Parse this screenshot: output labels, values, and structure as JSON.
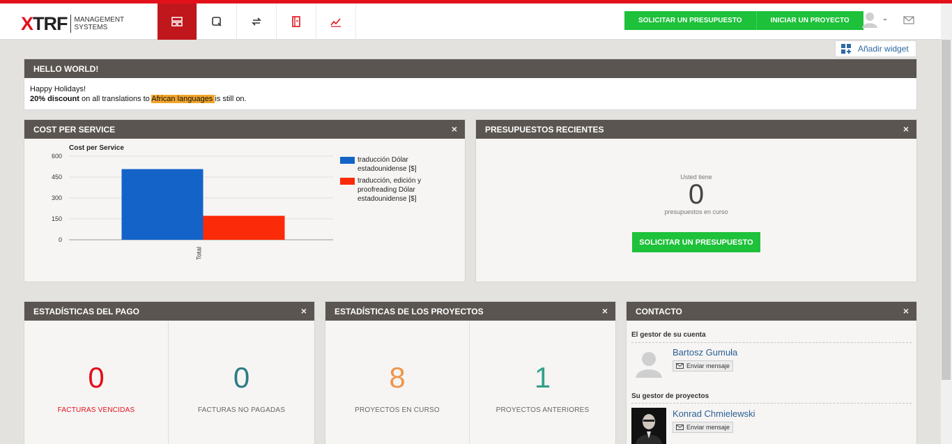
{
  "logo": {
    "mark": "XTRF",
    "line1": "MANAGEMENT",
    "line2": "SYSTEMS"
  },
  "nav": {
    "items": [
      "dashboard-icon",
      "search-icon",
      "refresh-icon",
      "book-icon",
      "chart-icon"
    ]
  },
  "header": {
    "btn_request_quote": "SOLICITAR UN PRESUPUESTO",
    "btn_start_project": "INICIAR UN PROYECTO"
  },
  "add_widget": "Añadir widget",
  "hello": {
    "title": "HELLO WORLD!",
    "line1": "Happy Holidays!",
    "bold": "20% discount",
    "mid": " on all translations to ",
    "highlight": "African languages ",
    "end": "is still on."
  },
  "cost_panel": {
    "title": "COST PER SERVICE",
    "close": "×"
  },
  "chart_data": {
    "type": "bar",
    "title": "Cost per Service",
    "categories": [
      "Total"
    ],
    "series": [
      {
        "name": "traducción Dólar estadounidense [$]",
        "values": [
          507
        ],
        "color": "#1463c9"
      },
      {
        "name": "traducción, edición y proofreading Dólar estadounidense [$]",
        "values": [
          172
        ],
        "color": "#fb2a08"
      }
    ],
    "yticks": [
      600,
      450,
      300,
      150,
      0
    ],
    "ylim": [
      0,
      600
    ],
    "legend": "right",
    "grid": true
  },
  "legend": {
    "s1_l1": "traducción Dólar",
    "s1_l2": "estadounidense [$]",
    "s2_l1": "traducción, edición y",
    "s2_l2": "proofreading Dólar",
    "s2_l3": "estadounidense [$]"
  },
  "quotes_panel": {
    "title": "PRESUPUESTOS RECIENTES",
    "close": "×",
    "you_have": "Usted tiene",
    "count": "0",
    "sub": "presupuestos en curso",
    "button": "SOLICITAR UN PRESUPUESTO"
  },
  "payment_panel": {
    "title": "ESTADÍSTICAS DEL PAGO",
    "close": "×",
    "overdue_value": "0",
    "overdue_label": "FACTURAS VENCIDAS",
    "unpaid_value": "0",
    "unpaid_label": "FACTURAS NO PAGADAS"
  },
  "projects_panel": {
    "title": "ESTADÍSTICAS DE LOS PROYECTOS",
    "close": "×",
    "ongoing_value": "8",
    "ongoing_label": "PROYECTOS EN CURSO",
    "past_value": "1",
    "past_label": "PROYECTOS ANTERIORES"
  },
  "contact_panel": {
    "title": "CONTACTO",
    "close": "×",
    "account_manager_heading": "El gestor de su cuenta",
    "account_manager_name": "Bartosz Gumuła",
    "project_manager_heading": "Su gestor de proyectos",
    "project_manager_name": "Konrad Chmielewski",
    "send_message": "Enviar mensaje"
  },
  "colors": {
    "red": "#e3101a",
    "green": "#1dc13a",
    "panel_head": "#5a5550",
    "teal": "#2d7b86",
    "orange": "#f0954a",
    "green_num": "#33a08a"
  }
}
